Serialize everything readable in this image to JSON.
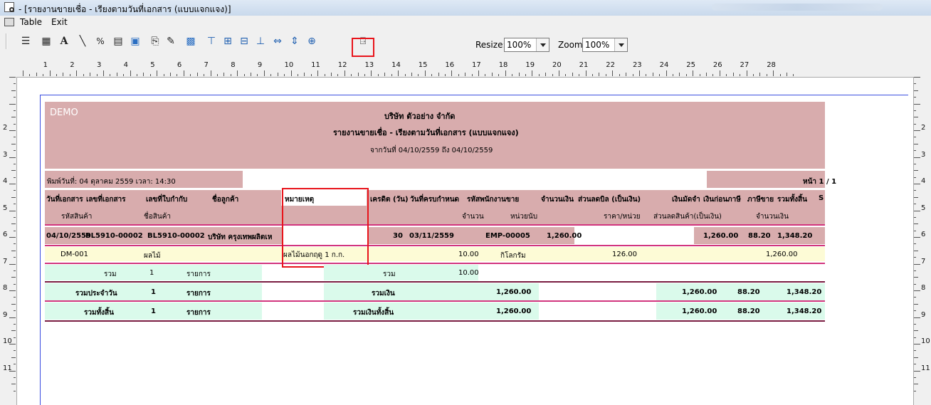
{
  "window": {
    "title": "- [รายงานขายเชื่อ - เรียงตามวันที่เอกสาร (แบบแจกแจง)]"
  },
  "menu": {
    "items": [
      "Table",
      "Exit"
    ]
  },
  "toolbar": {
    "resize_label": "Resize:",
    "resize_value": "100%",
    "zoom_label": "Zoom:",
    "zoom_value": "100%"
  },
  "ruler": {
    "h_marks": [
      "1",
      "2",
      "3",
      "4",
      "5",
      "6",
      "7",
      "8",
      "9",
      "10",
      "11",
      "12",
      "13",
      "14",
      "15",
      "16",
      "17",
      "18",
      "19",
      "20",
      "21",
      "22",
      "23",
      "24",
      "25",
      "26",
      "27",
      "28"
    ],
    "v_marks": [
      "2",
      "3",
      "4",
      "5",
      "6",
      "7",
      "8",
      "9",
      "10",
      "11"
    ]
  },
  "report": {
    "demo": "DEMO",
    "company": "บริษัท ตัวอย่าง จำกัด",
    "title": "รายงานขายเชื่อ - เรียงตามวันที่เอกสาร (แบบแจกแจง)",
    "date_range": "จากวันที่ 04/10/2559 ถึง 04/10/2559",
    "print_date": "พิมพ์วันที่: 04 ตุลาคม 2559 เวลา: 14:30",
    "page": "หน้า 1 / 1",
    "col_headers": {
      "doc_date": "วันที่เอกสาร",
      "doc_no": "เลขที่เอกสาร",
      "invoice_no": "เลขที่ใบกำกับ",
      "customer": "ชื่อลูกค้า",
      "remark": "หมายเหตุ",
      "credit": "เครดิต (วัน)",
      "due_date": "วันที่ครบกำหนด",
      "salesperson": "รหัสพนักงานขาย",
      "amount": "จำนวนเงิน",
      "bill_discount": "ส่วนลดบิล (เป็นเงิน)",
      "deposit": "เงินมัดจำ",
      "before_vat": "เงินก่อนภาษี",
      "vat": "ภาษีขาย",
      "total": "รวมทั้งสิ้น",
      "s": "S"
    },
    "sub_headers": {
      "item_code": "รหัสสินค้า",
      "item_name": "ชื่อสินค้า",
      "qty": "จำนวน",
      "unit": "หน่วยนับ",
      "unit_price": "ราคา/หน่วย",
      "item_discount": "ส่วนลดสินค้า(เป็นเงิน)",
      "item_amount": "จำนวนเงิน"
    },
    "doc_row": {
      "doc_date": "04/10/2559",
      "doc_no": "BL5910-00002",
      "invoice_no": "BL5910-00002",
      "customer": "บริษัท ครุงเทพผลิตเห",
      "credit": "30",
      "due_date": "03/11/2559",
      "salesperson": "EMP-00005",
      "amount": "1,260.00",
      "before_vat": "1,260.00",
      "vat": "88.20",
      "total": "1,348.20"
    },
    "item_row": {
      "item_code": "DM-001",
      "item_name": "ผลไม้",
      "remark": "ผลไม้นอกฤดู 1 ก.ก.",
      "qty": "10.00",
      "unit": "กิโลกรัม",
      "unit_price": "126.00",
      "item_amount": "1,260.00"
    },
    "sum_row": {
      "label": "รวม",
      "count": "1",
      "count_unit": "รายการ",
      "label2": "รวม",
      "qty": "10.00"
    },
    "daily_row": {
      "label": "รวมประจำวัน",
      "count": "1",
      "count_unit": "รายการ",
      "label2": "รวมเงิน",
      "amount": "1,260.00",
      "before_vat": "1,260.00",
      "vat": "88.20",
      "total": "1,348.20"
    },
    "grand_row": {
      "label": "รวมทั้งสิ้น",
      "count": "1",
      "count_unit": "รายการ",
      "label2": "รวมเงินทั้งสิ้น",
      "amount": "1,260.00",
      "before_vat": "1,260.00",
      "vat": "88.20",
      "total": "1,348.20"
    }
  },
  "colors": {
    "header_band": "#d8acad",
    "accent_line": "#d2357e",
    "total_fill": "#dafaeb",
    "highlight_box": "#e8141b"
  }
}
